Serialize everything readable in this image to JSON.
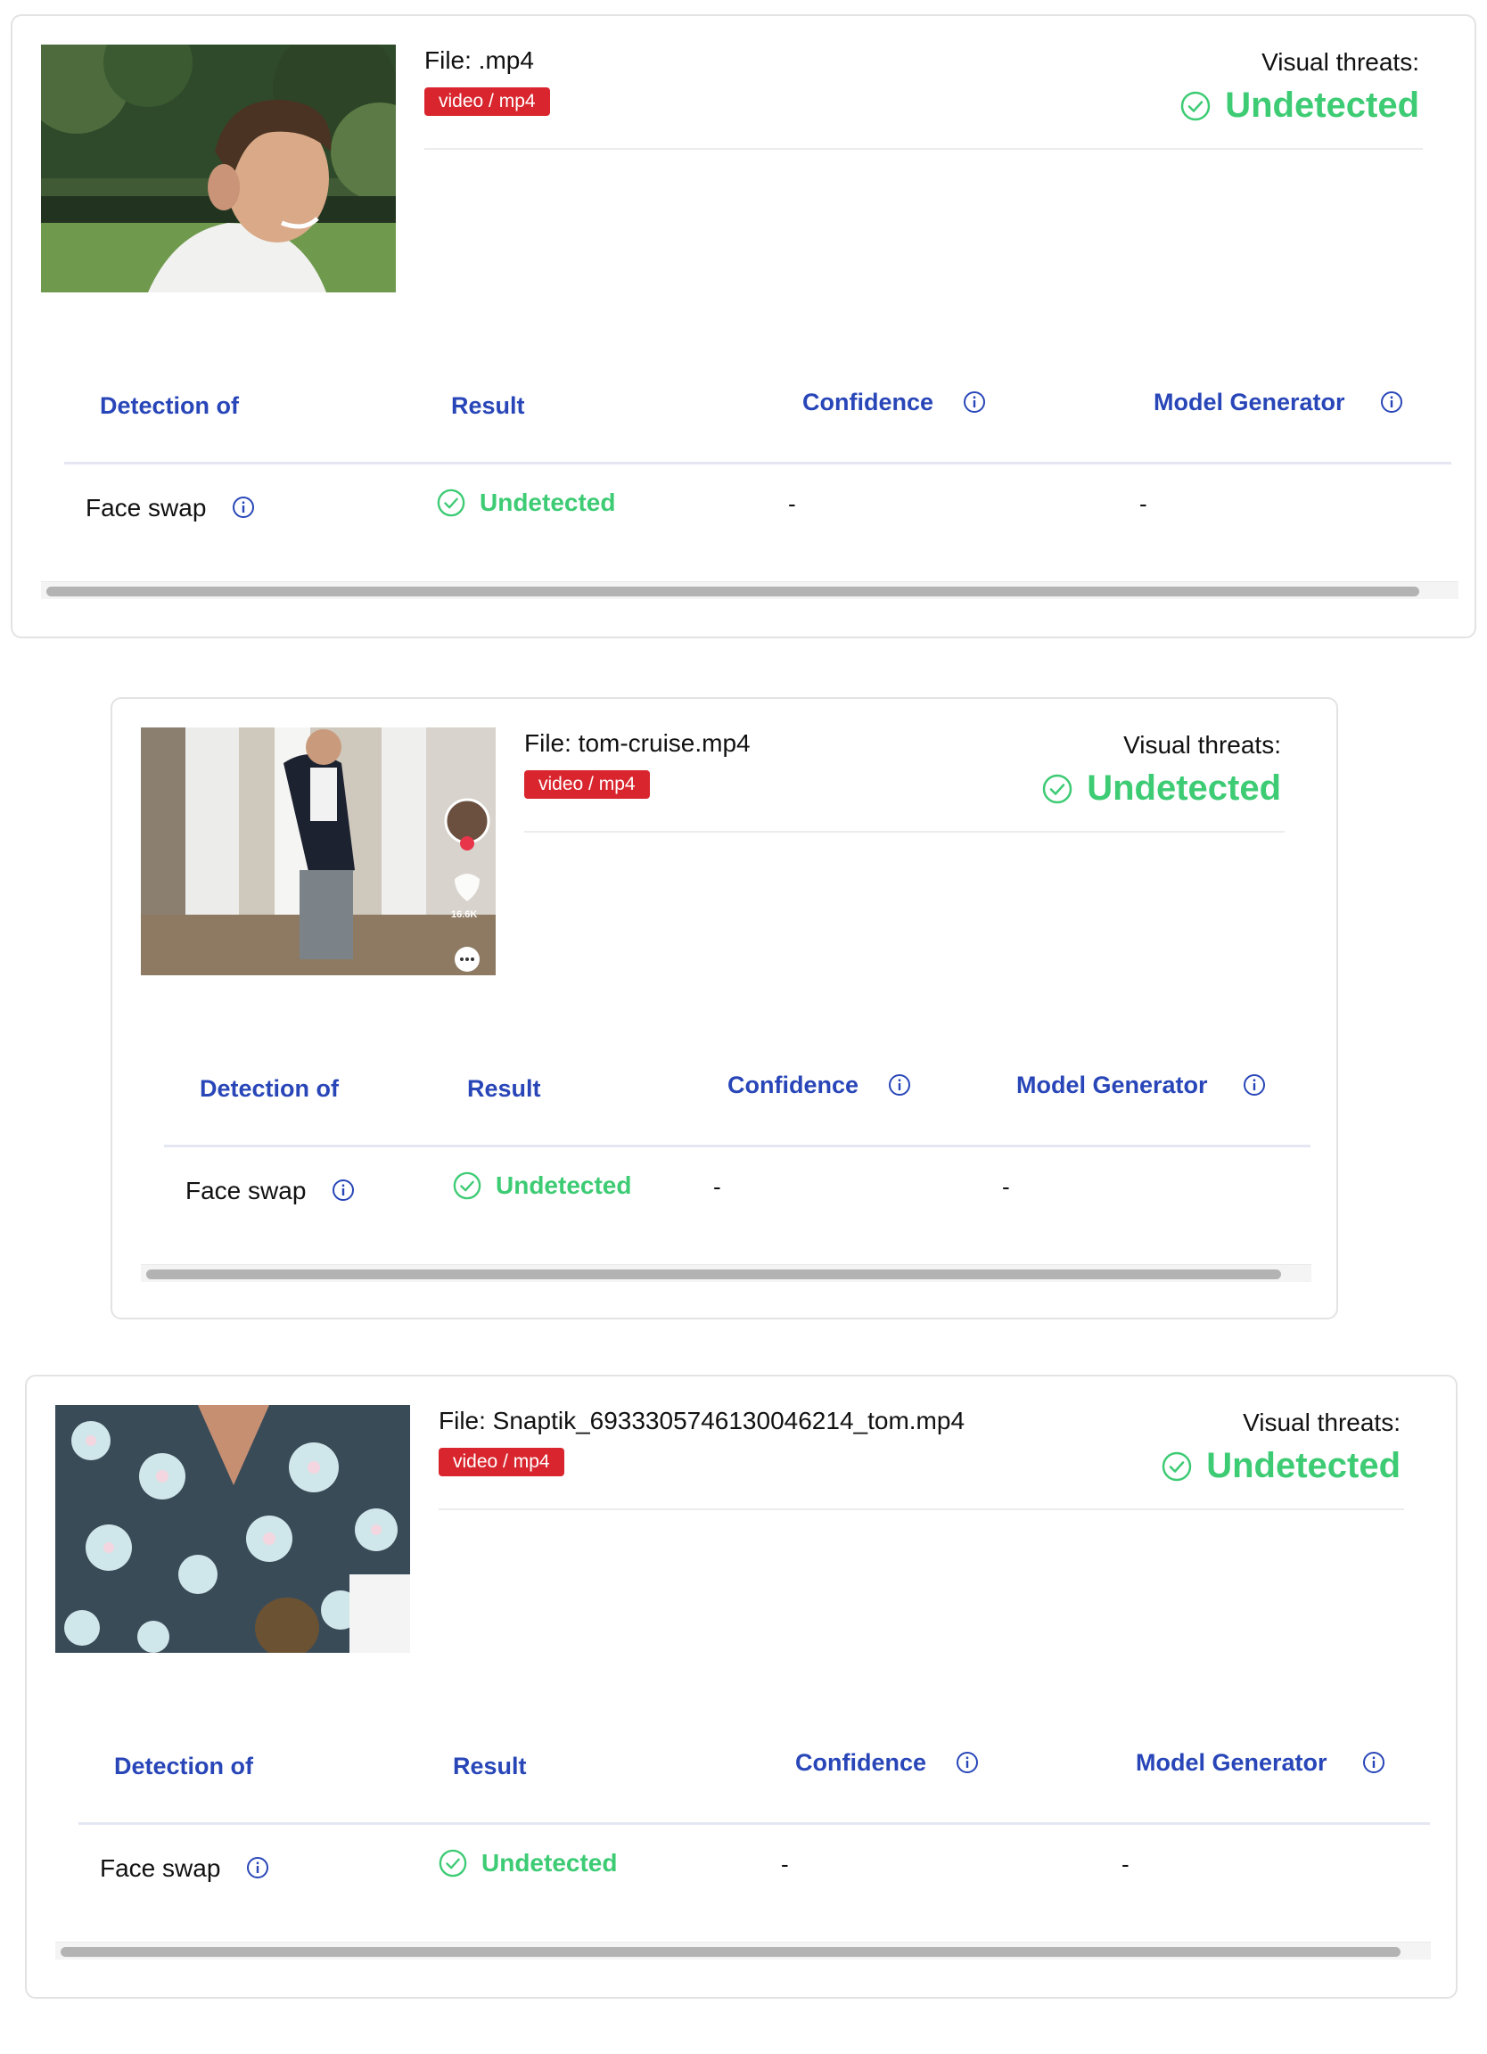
{
  "colors": {
    "accent_blue": "#2846b8",
    "success_green": "#3dcb74",
    "badge_red": "#d9262e"
  },
  "cards": [
    {
      "file_label": "File: .mp4",
      "mime": "video / mp4",
      "threat_label": "Visual threats:",
      "threat_status": "Undetected",
      "thumbnail_icon": "man-portrait-image",
      "columns": [
        "Detection of",
        "Result",
        "Confidence",
        "Model Generator"
      ],
      "row": {
        "detection": "Face swap",
        "result": "Undetected",
        "confidence": "-",
        "model_generator": "-"
      }
    },
    {
      "file_label": "File: tom-cruise.mp4",
      "mime": "video / mp4",
      "threat_label": "Visual threats:",
      "threat_status": "Undetected",
      "thumbnail_icon": "hallway-video-frame",
      "thumbnail_overlay_text": "16.6K",
      "columns": [
        "Detection of",
        "Result",
        "Confidence",
        "Model Generator"
      ],
      "row": {
        "detection": "Face swap",
        "result": "Undetected",
        "confidence": "-",
        "model_generator": "-"
      }
    },
    {
      "file_label": "File: Snaptik_6933305746130046214_tom.mp4",
      "mime": "video / mp4",
      "threat_label": "Visual threats:",
      "threat_status": "Undetected",
      "thumbnail_icon": "floral-shirt-video-frame",
      "columns": [
        "Detection of",
        "Result",
        "Confidence",
        "Model Generator"
      ],
      "row": {
        "detection": "Face swap",
        "result": "Undetected",
        "confidence": "-",
        "model_generator": "-"
      }
    }
  ]
}
